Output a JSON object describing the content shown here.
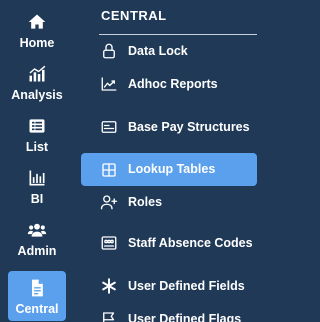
{
  "rail": {
    "items": [
      {
        "label": "Home",
        "icon": "home-icon",
        "active": false
      },
      {
        "label": "Analysis",
        "icon": "analysis-icon",
        "active": false
      },
      {
        "label": "List",
        "icon": "list-icon",
        "active": false
      },
      {
        "label": "BI",
        "icon": "bi-chart-icon",
        "active": false
      },
      {
        "label": "Admin",
        "icon": "admin-users-icon",
        "active": false
      },
      {
        "label": "Central",
        "icon": "document-icon",
        "active": true
      }
    ]
  },
  "panel": {
    "title": "CENTRAL",
    "items": [
      {
        "label": "Data Lock",
        "icon": "lock-icon",
        "active": false
      },
      {
        "label": "Adhoc Reports",
        "icon": "line-chart-icon",
        "active": false
      },
      {
        "label": "Base Pay Structures",
        "icon": "id-card-icon",
        "active": false
      },
      {
        "label": "Lookup Tables",
        "icon": "table-icon",
        "active": true
      },
      {
        "label": "Roles",
        "icon": "user-plus-icon",
        "active": false
      },
      {
        "label": "Staff Absence Codes",
        "icon": "users-grid-icon",
        "active": false
      },
      {
        "label": "User Defined Fields",
        "icon": "asterisk-icon",
        "active": false
      },
      {
        "label": "User Defined Flags",
        "icon": "flag-icon",
        "active": false
      }
    ]
  },
  "colors": {
    "background": "#1f3957",
    "active": "#5aa0ec",
    "text": "#ffffff"
  }
}
